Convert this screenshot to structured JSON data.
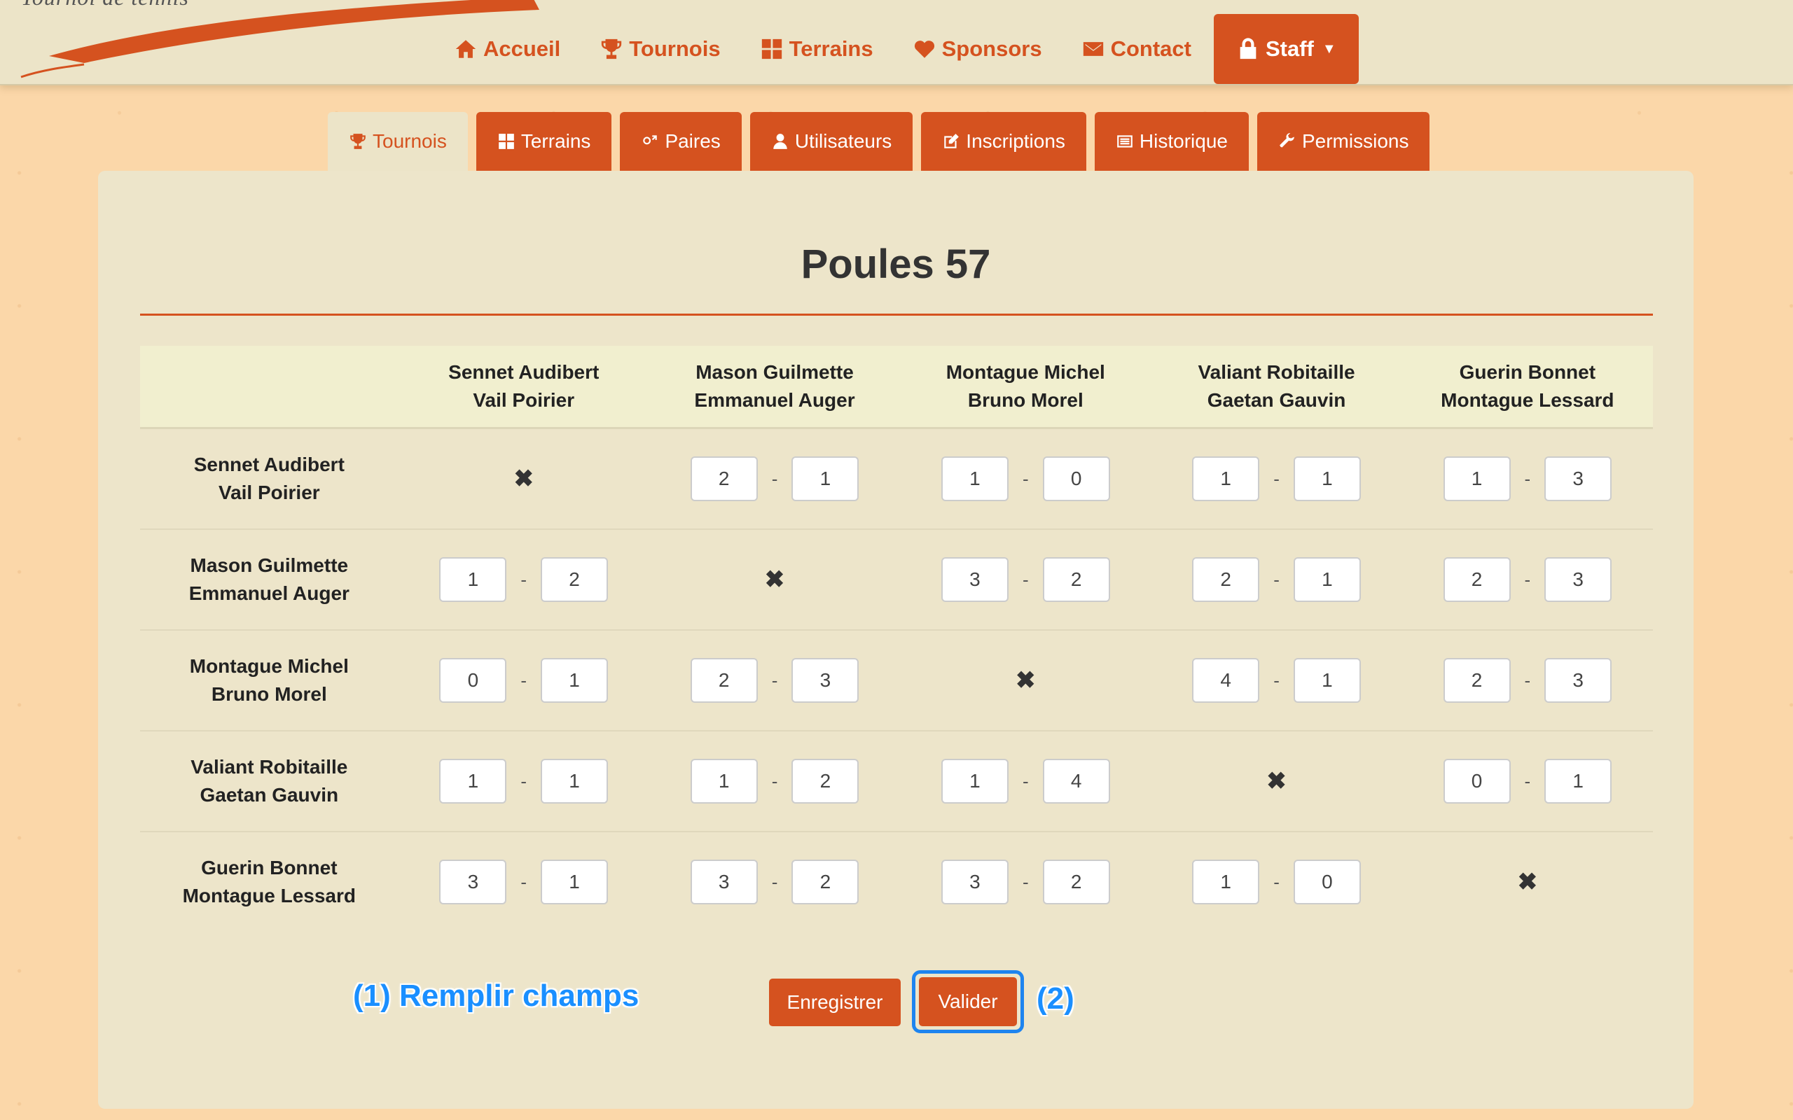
{
  "brand": {
    "text": "Tournoi de tennis"
  },
  "nav": {
    "items": [
      {
        "label": "Accueil",
        "icon": "home-icon"
      },
      {
        "label": "Tournois",
        "icon": "trophy-icon"
      },
      {
        "label": "Terrains",
        "icon": "grid-icon"
      },
      {
        "label": "Sponsors",
        "icon": "heart-icon"
      },
      {
        "label": "Contact",
        "icon": "envelope-icon"
      }
    ],
    "staff": {
      "label": "Staff",
      "icon": "lock-icon"
    }
  },
  "tabs": [
    {
      "label": "Tournois",
      "icon": "trophy-icon",
      "active": true
    },
    {
      "label": "Terrains",
      "icon": "grid-icon"
    },
    {
      "label": "Paires",
      "icon": "gender-icon"
    },
    {
      "label": "Utilisateurs",
      "icon": "user-icon"
    },
    {
      "label": "Inscriptions",
      "icon": "edit-icon"
    },
    {
      "label": "Historique",
      "icon": "list-icon"
    },
    {
      "label": "Permissions",
      "icon": "wrench-icon"
    }
  ],
  "page": {
    "title": "Poules 57"
  },
  "teams": [
    {
      "line1": "Sennet Audibert",
      "line2": "Vail Poirier"
    },
    {
      "line1": "Mason Guilmette",
      "line2": "Emmanuel Auger"
    },
    {
      "line1": "Montague Michel",
      "line2": "Bruno Morel"
    },
    {
      "line1": "Valiant Robitaille",
      "line2": "Gaetan Gauvin"
    },
    {
      "line1": "Guerin Bonnet",
      "line2": "Montague Lessard"
    }
  ],
  "scores": [
    [
      null,
      [
        "2",
        "1"
      ],
      [
        "1",
        "0"
      ],
      [
        "1",
        "1"
      ],
      [
        "1",
        "3"
      ]
    ],
    [
      [
        "1",
        "2"
      ],
      null,
      [
        "3",
        "2"
      ],
      [
        "2",
        "1"
      ],
      [
        "2",
        "3"
      ]
    ],
    [
      [
        "0",
        "1"
      ],
      [
        "2",
        "3"
      ],
      null,
      [
        "4",
        "1"
      ],
      [
        "2",
        "3"
      ]
    ],
    [
      [
        "1",
        "1"
      ],
      [
        "1",
        "2"
      ],
      [
        "1",
        "4"
      ],
      null,
      [
        "0",
        "1"
      ]
    ],
    [
      [
        "3",
        "1"
      ],
      [
        "3",
        "2"
      ],
      [
        "3",
        "2"
      ],
      [
        "1",
        "0"
      ],
      null
    ]
  ],
  "self_mark": "✖",
  "separator": "-",
  "actions": {
    "save_label": "Enregistrer",
    "validate_label": "Valider"
  },
  "annotations": {
    "step1": "(1) Remplir champs",
    "step2": "(2)"
  },
  "colors": {
    "accent": "#d5521f",
    "panel": "#ede5ca",
    "highlight": "#1e84ef",
    "annotation": "#1a8fff"
  }
}
